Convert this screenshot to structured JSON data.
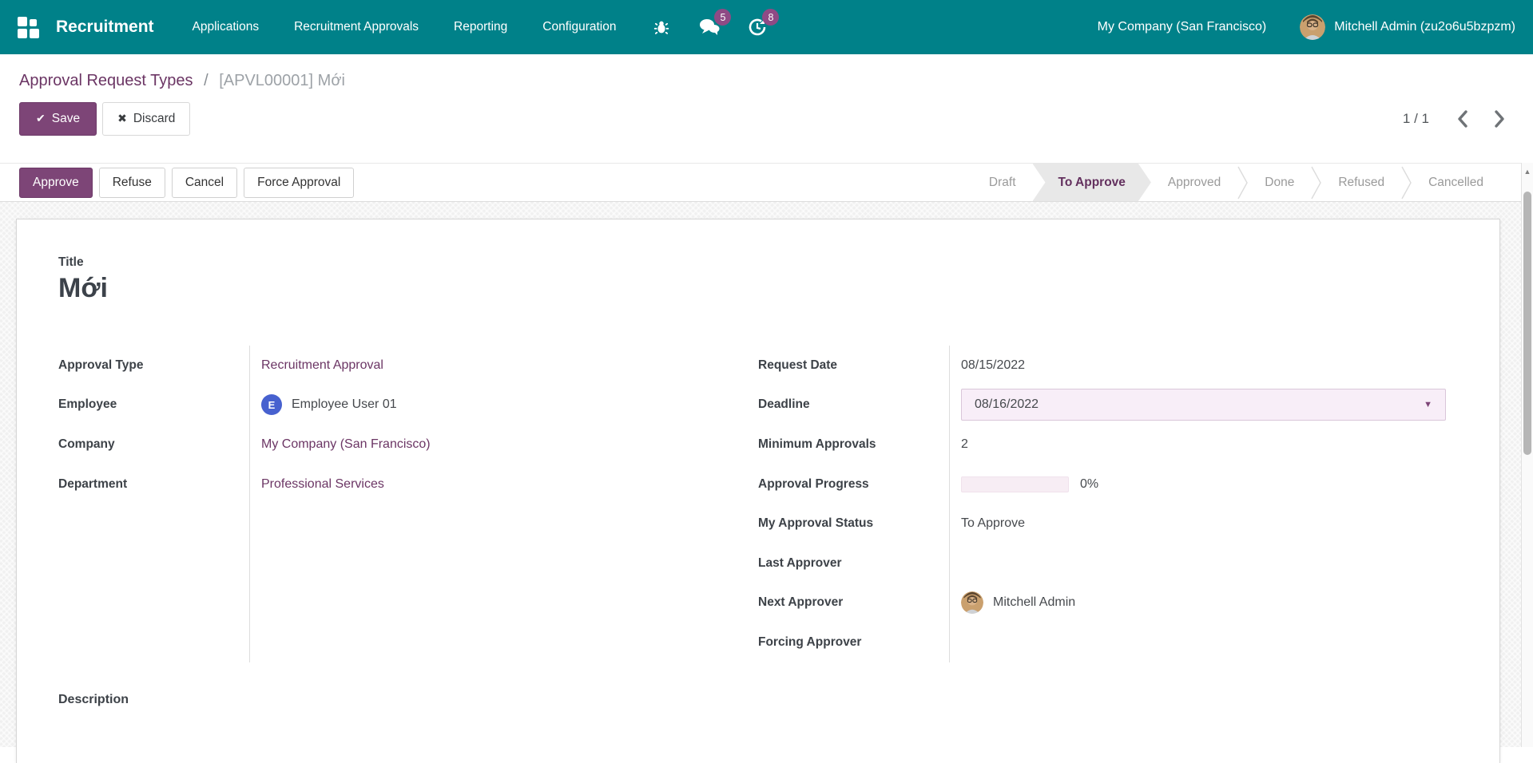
{
  "topbar": {
    "app_name": "Recruitment",
    "menus": [
      {
        "label": "Applications"
      },
      {
        "label": "Recruitment Approvals"
      },
      {
        "label": "Reporting"
      },
      {
        "label": "Configuration"
      }
    ],
    "message_badge": "5",
    "activity_badge": "8",
    "company": "My Company (San Francisco)",
    "user": "Mitchell Admin (zu2o6u5bzpzm)"
  },
  "breadcrumb": {
    "parent": "Approval Request Types",
    "separator": "/",
    "current": "[APVL00001] Mới"
  },
  "actions": {
    "save_icon": "✔",
    "save_label": "Save",
    "discard_icon": "✖",
    "discard_label": "Discard"
  },
  "pager": {
    "text": "1 / 1"
  },
  "header_buttons": [
    {
      "label": "Approve"
    },
    {
      "label": "Refuse"
    },
    {
      "label": "Cancel"
    },
    {
      "label": "Force Approval"
    }
  ],
  "statusbar": {
    "stages": [
      "Draft",
      "To Approve",
      "Approved",
      "Done",
      "Refused",
      "Cancelled"
    ],
    "active": "To Approve"
  },
  "form": {
    "title_label": "Title",
    "title_value": "Mới",
    "left_fields": [
      {
        "label": "Approval Type",
        "value": "Recruitment Approval"
      },
      {
        "label": "Employee",
        "value": "Employee User 01",
        "avatar_initial": "E"
      },
      {
        "label": "Company",
        "value": "My Company (San Francisco)"
      },
      {
        "label": "Department",
        "value": "Professional Services"
      }
    ],
    "right_fields": [
      {
        "label": "Request Date",
        "value": "08/15/2022"
      },
      {
        "label": "Deadline",
        "value": "08/16/2022",
        "caret": "▼"
      },
      {
        "label": "Minimum Approvals",
        "value": "2"
      },
      {
        "label": "Approval Progress",
        "value": "0%",
        "progress_percent": 0
      },
      {
        "label": "My Approval Status",
        "value": "To Approve"
      },
      {
        "label": "Last Approver",
        "value": ""
      },
      {
        "label": "Next Approver",
        "value": "Mitchell Admin"
      },
      {
        "label": "Forcing Approver",
        "value": ""
      }
    ],
    "description_label": "Description"
  },
  "colors": {
    "topbar_teal": "#008189",
    "primary_purple": "#7d4577",
    "link_purple": "#6b3564",
    "badge_magenta": "#8f4a85",
    "employee_avatar_blue": "#4761cf",
    "stage_active_bg": "#e8e8e8",
    "deadline_field_bg": "#f8eef8",
    "progress_track_bg": "#f7edf4"
  }
}
